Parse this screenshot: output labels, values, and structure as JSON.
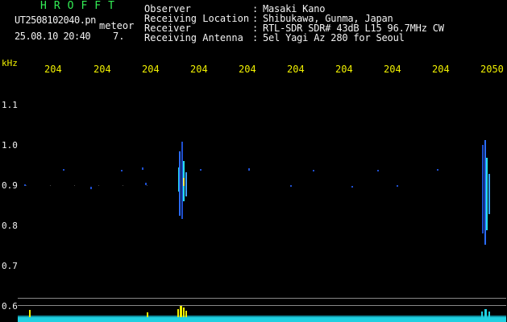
{
  "header": {
    "brand": "HROFFT",
    "file_name": "UT2508102040.pn",
    "meteor_label": "meteor",
    "datetime": "25.08.10 20:40",
    "count": "7."
  },
  "info": [
    {
      "label": "Observer",
      "value": "Masaki Kano"
    },
    {
      "label": "Receiving Location",
      "value": "Shibukawa, Gunma, Japan"
    },
    {
      "label": "Receiver",
      "value": "RTL-SDR SDR# 43dB L15 96.7MHz CW"
    },
    {
      "label": "Receiving Antenna",
      "value": "5el Yagi Az 280 for Seoul"
    }
  ],
  "info_colon": ":",
  "axis": {
    "y_unit": "kHz",
    "time_ticks": [
      "204",
      "204",
      "204",
      "204",
      "204",
      "204",
      "204",
      "204",
      "204",
      "2050"
    ],
    "freq_ticks": [
      "1.1",
      "1.0",
      "0.9",
      "0.8",
      "0.7",
      "0.6"
    ]
  },
  "colors": {
    "background": "#000000",
    "text": "#f2f2f2",
    "brand_green": "#33ee55",
    "tick_yellow": "#f0f000",
    "signal_blue": "#2a6bff",
    "signal_cyan": "#26e0ee",
    "spectrum_cyan": "#1fd0e0",
    "spectrum_yellow": "#f0f000"
  }
}
